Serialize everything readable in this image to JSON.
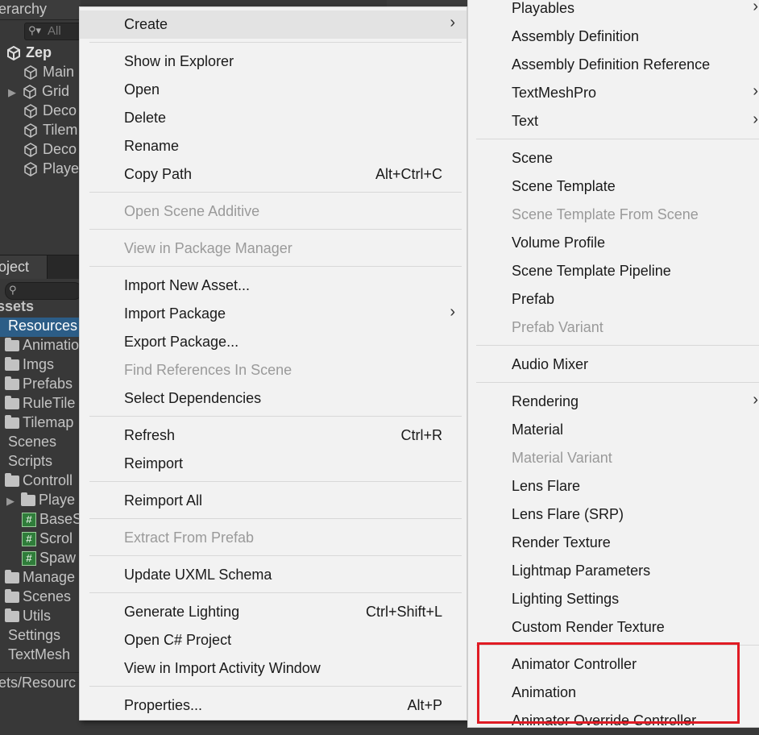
{
  "hierarchy": {
    "title": "erarchy",
    "search_icon": "search-icon",
    "search_placeholder": "All",
    "scene_name": "Zep",
    "items": [
      {
        "label": "Main"
      },
      {
        "label": "Grid"
      },
      {
        "label": "Deco"
      },
      {
        "label": "Tilem"
      },
      {
        "label": "Deco"
      },
      {
        "label": "Playe"
      }
    ]
  },
  "project": {
    "tab_label": "oject",
    "root_label": "ssets",
    "items": [
      {
        "label": "Resources"
      },
      {
        "label": "Animatio"
      },
      {
        "label": "Imgs"
      },
      {
        "label": "Prefabs"
      },
      {
        "label": "RuleTile"
      },
      {
        "label": "Tilemap"
      },
      {
        "label": "Scenes"
      },
      {
        "label": "Scripts"
      },
      {
        "label": "Controll"
      },
      {
        "label": "Playe"
      },
      {
        "label": "BaseS"
      },
      {
        "label": "Scrol"
      },
      {
        "label": "Spaw"
      },
      {
        "label": "Manage"
      },
      {
        "label": "Scenes"
      },
      {
        "label": "Utils"
      },
      {
        "label": "Settings"
      },
      {
        "label": "TextMesh"
      }
    ],
    "path": "ets/Resourc"
  },
  "main_menu": {
    "items": [
      {
        "label": "Create",
        "submenu": true,
        "highlighted": true
      },
      {
        "label": "Show in Explorer"
      },
      {
        "label": "Open"
      },
      {
        "label": "Delete"
      },
      {
        "label": "Rename"
      },
      {
        "label": "Copy Path",
        "shortcut": "Alt+Ctrl+C"
      },
      {
        "label": "Open Scene Additive",
        "disabled": true
      },
      {
        "label": "View in Package Manager",
        "disabled": true
      },
      {
        "label": "Import New Asset..."
      },
      {
        "label": "Import Package",
        "submenu": true
      },
      {
        "label": "Export Package..."
      },
      {
        "label": "Find References In Scene",
        "disabled": true
      },
      {
        "label": "Select Dependencies"
      },
      {
        "label": "Refresh",
        "shortcut": "Ctrl+R"
      },
      {
        "label": "Reimport"
      },
      {
        "label": "Reimport All"
      },
      {
        "label": "Extract From Prefab",
        "disabled": true
      },
      {
        "label": "Update UXML Schema"
      },
      {
        "label": "Generate Lighting",
        "shortcut": "Ctrl+Shift+L"
      },
      {
        "label": "Open C# Project"
      },
      {
        "label": "View in Import Activity Window"
      },
      {
        "label": "Properties...",
        "shortcut": "Alt+P"
      }
    ]
  },
  "create_submenu": {
    "items": [
      {
        "label": "Playables",
        "submenu": true
      },
      {
        "label": "Assembly Definition"
      },
      {
        "label": "Assembly Definition Reference"
      },
      {
        "label": "TextMeshPro",
        "submenu": true
      },
      {
        "label": "Text",
        "submenu": true
      },
      {
        "label": "Scene"
      },
      {
        "label": "Scene Template"
      },
      {
        "label": "Scene Template From Scene",
        "disabled": true
      },
      {
        "label": "Volume Profile"
      },
      {
        "label": "Scene Template Pipeline"
      },
      {
        "label": "Prefab"
      },
      {
        "label": "Prefab Variant",
        "disabled": true
      },
      {
        "label": "Audio Mixer"
      },
      {
        "label": "Rendering",
        "submenu": true
      },
      {
        "label": "Material"
      },
      {
        "label": "Material Variant",
        "disabled": true
      },
      {
        "label": "Lens Flare"
      },
      {
        "label": "Lens Flare (SRP)"
      },
      {
        "label": "Render Texture"
      },
      {
        "label": "Lightmap Parameters"
      },
      {
        "label": "Lighting Settings"
      },
      {
        "label": "Custom Render Texture"
      },
      {
        "label": "Animator Controller"
      },
      {
        "label": "Animation"
      },
      {
        "label": "Animator Override Controller"
      }
    ]
  },
  "colors": {
    "highlight_box": "#e01b24",
    "selection": "#2c5d87",
    "menu_bg": "#f2f2f2"
  }
}
